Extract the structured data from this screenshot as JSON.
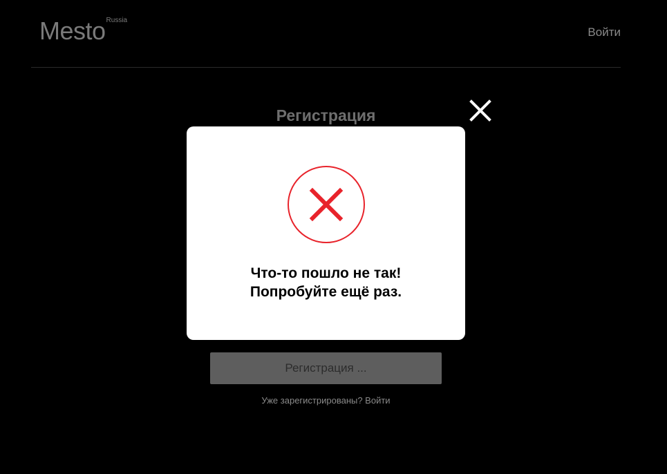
{
  "header": {
    "logo_text": "Mesto",
    "logo_sup": "Russia",
    "login_link": "Войти"
  },
  "form": {
    "title": "Регистрация",
    "submit_label": "Регистрация ...",
    "login_hint": "Уже зарегистрированы? Войти"
  },
  "modal": {
    "icon": "error-cross-icon",
    "message_line1": "Что-то пошло не так!",
    "message_line2": "Попробуйте ещё раз.",
    "close_icon": "close-icon"
  },
  "colors": {
    "background": "#000000",
    "modal_bg": "#ffffff",
    "error_red": "#e8232b",
    "muted_text": "#7a7a7a"
  }
}
